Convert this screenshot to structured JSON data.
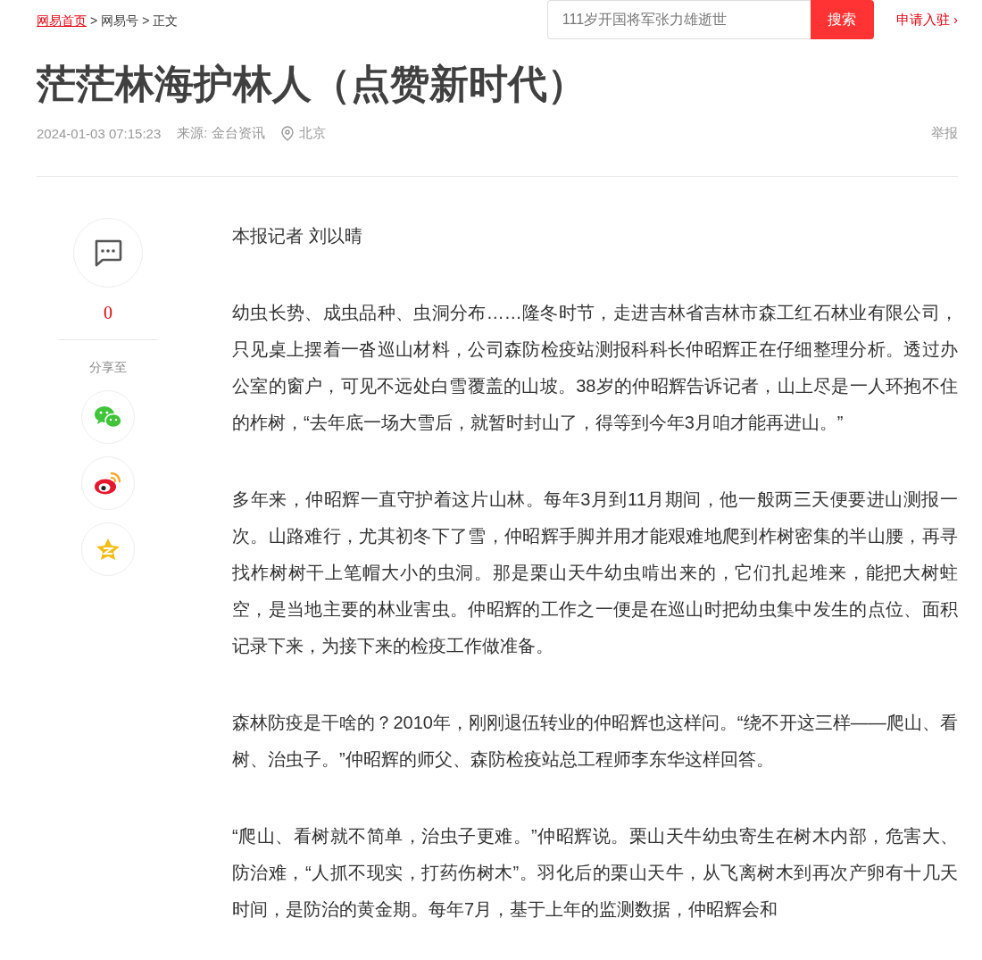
{
  "breadcrumb": [
    {
      "label": "网易首页",
      "kind": "link"
    },
    {
      "label": ">",
      "kind": "separator"
    },
    {
      "label": "网易号",
      "kind": "crumb"
    },
    {
      "label": ">",
      "kind": "separator"
    },
    {
      "label": "正文",
      "kind": "crumb"
    }
  ],
  "search": {
    "placeholder": "111岁开国将军张力雄逝世",
    "button": "搜索"
  },
  "apply_link": "申请入驻 ›",
  "article": {
    "title": "茫茫林海护林人（点赞新时代）",
    "datetime": "2024-01-03 07:15:23",
    "source": "来源: 金台资讯",
    "location": "北京",
    "report": "举报",
    "paragraphs": [
      "本报记者 刘以晴",
      "幼虫长势、成虫品种、虫洞分布……隆冬时节，走进吉林省吉林市森工红石林业有限公司，只见桌上摆着一沓巡山材料，公司森防检疫站测报科科长仲昭辉正在仔细整理分析。透过办公室的窗户，可见不远处白雪覆盖的山坡。38岁的仲昭辉告诉记者，山上尽是一人环抱不住的柞树，“去年底一场大雪后，就暂时封山了，得等到今年3月咱才能再进山。”",
      "多年来，仲昭辉一直守护着这片山林。每年3月到11月期间，他一般两三天便要进山测报一次。山路难行，尤其初冬下了雪，仲昭辉手脚并用才能艰难地爬到柞树密集的半山腰，再寻找柞树树干上笔帽大小的虫洞。那是栗山天牛幼虫啃出来的，它们扎起堆来，能把大树蛀空，是当地主要的林业害虫。仲昭辉的工作之一便是在巡山时把幼虫集中发生的点位、面积记录下来，为接下来的检疫工作做准备。",
      "森林防疫是干啥的？2010年，刚刚退伍转业的仲昭辉也这样问。“绕不开这三样——爬山、看树、治虫子。”仲昭辉的师父、森防检疫站总工程师李东华这样回答。",
      "“爬山、看树就不简单，治虫子更难。”仲昭辉说。栗山天牛幼虫寄生在树木内部，危害大、防治难，“人抓不现实，打药伤树木”。羽化后的栗山天牛，从飞离树木到再次产卵有十几天时间，是防治的黄金期。每年7月，基于上年的监测数据，仲昭辉会和"
    ]
  },
  "sidebar": {
    "comment_count": "0",
    "share_label": "分享至",
    "share_targets": [
      {
        "kind": "wechat"
      },
      {
        "kind": "weibo"
      },
      {
        "kind": "qzone"
      }
    ]
  }
}
